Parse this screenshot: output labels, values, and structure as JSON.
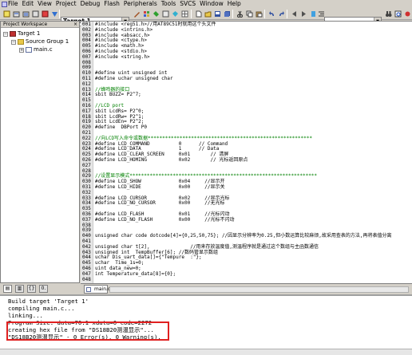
{
  "menu": [
    "File",
    "Edit",
    "View",
    "Project",
    "Debug",
    "Flash",
    "Peripherals",
    "Tools",
    "SVCS",
    "Window",
    "Help"
  ],
  "toolbar": {
    "target": "Target 1"
  },
  "workspace": {
    "title": "Project Workspace",
    "close": "×",
    "root": "Target 1",
    "group": "Source Group 1",
    "file": "main.c"
  },
  "editor": {
    "tab": "main.c",
    "lines": [
      {
        "n": "001",
        "t": "#include <reg51.h>//用AT89C51时就用这个头文件"
      },
      {
        "n": "002",
        "t": "#include <intrins.h>"
      },
      {
        "n": "003",
        "t": "#include <absacc.h>"
      },
      {
        "n": "004",
        "t": "#include <ctype.h>"
      },
      {
        "n": "005",
        "t": "#include <math.h>"
      },
      {
        "n": "006",
        "t": "#include <stdio.h>"
      },
      {
        "n": "007",
        "t": "#include <string.h>"
      },
      {
        "n": "008",
        "t": ""
      },
      {
        "n": "009",
        "t": ""
      },
      {
        "n": "010",
        "t": "#define uint unsigned int"
      },
      {
        "n": "011",
        "t": "#define uchar unsigned char"
      },
      {
        "n": "012",
        "t": ""
      },
      {
        "n": "013",
        "t": "//蜂鸣器的接口"
      },
      {
        "n": "014",
        "t": "sbit BUZZ= P2^7;"
      },
      {
        "n": "015",
        "t": ""
      },
      {
        "n": "016",
        "t": "//LCD port"
      },
      {
        "n": "017",
        "t": "sbit LcdRs= P2^0;"
      },
      {
        "n": "018",
        "t": "sbit LcdRw= P2^1;"
      },
      {
        "n": "019",
        "t": "sbit LcdEn= P2^2;"
      },
      {
        "n": "020",
        "t": "#define  DBPort P0"
      },
      {
        "n": "021",
        "t": ""
      },
      {
        "n": "022",
        "t": "//向LCD写入命令或数据*********************************************************"
      },
      {
        "n": "023",
        "t": "#define LCD_COMMAND          0      // Command"
      },
      {
        "n": "024",
        "t": "#define LCD_DATA             1      // Data"
      },
      {
        "n": "025",
        "t": "#define LCD_CLEAR_SCREEN     0x01       // 清屏"
      },
      {
        "n": "026",
        "t": "#define LCD_HOMING           0x02       // 光标返回原点"
      },
      {
        "n": "027",
        "t": ""
      },
      {
        "n": "028",
        "t": ""
      },
      {
        "n": "029",
        "t": "//设置显示模式*****************************************************************"
      },
      {
        "n": "030",
        "t": "#define LCD_SHOW             0x04     //显示开"
      },
      {
        "n": "031",
        "t": "#define LCD_HIDE             0x00     //显示关"
      },
      {
        "n": "032",
        "t": ""
      },
      {
        "n": "033",
        "t": "#define LCD_CURSOR           0x02     //显示光标"
      },
      {
        "n": "034",
        "t": "#define LCD_NO_CURSOR        0x00     //无光标"
      },
      {
        "n": "035",
        "t": ""
      },
      {
        "n": "036",
        "t": "#define LCD_FLASH            0x01     //光标闪动"
      },
      {
        "n": "037",
        "t": "#define LCD_NO_FLASH         0x00     //光标不闪动"
      },
      {
        "n": "038",
        "t": ""
      },
      {
        "n": "039",
        "t": ""
      },
      {
        "n": "040",
        "t": "unsigned char code dotcode[4]={0,25,50,75}; //因显示分辨率为0.25,但小数运算比较麻烦,故采用查表的方法,再将表值分离"
      },
      {
        "n": "041",
        "t": ""
      },
      {
        "n": "042",
        "t": "unsigned char t[2],              //用来存放温度值,测温程序就是通过这个数组与主函数通信"
      },
      {
        "n": "043",
        "t": "unsigned int  TempBuffer[6]; //数码管显示数组"
      },
      {
        "n": "044",
        "t": "uchar Dis_uart_data[]={\"Tempure  :\"};"
      },
      {
        "n": "045",
        "t": "uchar  Time_1s=0;"
      },
      {
        "n": "046",
        "t": "uint data_new=0;"
      },
      {
        "n": "047",
        "t": "int Temperature_data[8]={0};"
      },
      {
        "n": "048",
        "t": ""
      }
    ]
  },
  "build": {
    "lines": [
      "Build target 'Target 1'",
      "compiling main.c...",
      "linking...",
      "Program Size: data=70.1 xdata=0 code=2272",
      "creating hex file from \"DS18B20测温显示\"...",
      "\"DS18B20测温显示\" - 0 Error(s), 0 Warning(s)."
    ]
  },
  "colors": {
    "comment": "#008000",
    "keyword": "#0000d0",
    "highlight": "#e02020"
  }
}
